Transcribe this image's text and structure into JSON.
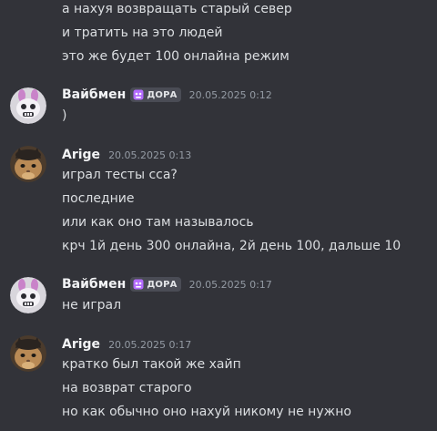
{
  "messages": [
    {
      "continued": true,
      "lines": [
        "а нахуя возвращать старый север",
        "и тратить на это людей",
        "это же будет 100 онлайна режим"
      ]
    },
    {
      "author": "Вайбмен",
      "tag": "ДОРА",
      "avatar": "cartoon-bunny-avatar",
      "timestamp": "20.05.2025 0:12",
      "lines": [
        ")"
      ]
    },
    {
      "author": "Arige",
      "avatar": "cat-photo-avatar",
      "timestamp": "20.05.2025 0:13",
      "lines": [
        "играл тесты сса?",
        "последние",
        "или как оно там называлось",
        "крч 1й день 300 онлайна, 2й день 100, дальше 10"
      ]
    },
    {
      "author": "Вайбмен",
      "tag": "ДОРА",
      "avatar": "cartoon-bunny-avatar",
      "timestamp": "20.05.2025 0:17",
      "lines": [
        "не играл"
      ]
    },
    {
      "author": "Arige",
      "avatar": "cat-photo-avatar",
      "timestamp": "20.05.2025 0:17",
      "lines": [
        "кратко был такой же хайп",
        "на возврат старого",
        "но как обычно оно нахуй никому не нужно"
      ]
    }
  ],
  "colors": {
    "background": "#323339",
    "text": "#dbdee1",
    "username": "#f2f3f5",
    "timestamp": "#949ba4",
    "tag_background": "#4a4c55",
    "tag_icon": "#b46bff"
  }
}
